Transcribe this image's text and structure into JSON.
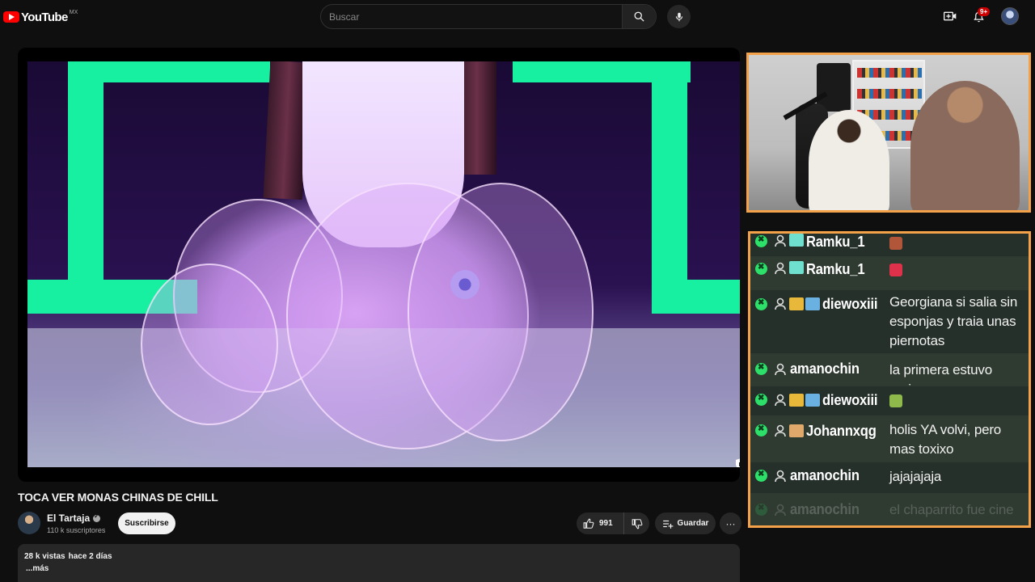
{
  "header": {
    "logo_text": "YouTube",
    "country_code": "MX",
    "search_placeholder": "Buscar",
    "notifications_badge": "9+",
    "icons": [
      "search-icon",
      "mic-icon",
      "create-icon",
      "bell-icon",
      "avatar"
    ]
  },
  "video": {
    "title": "TOCA VER MONAS CHINAS DE CHILL",
    "channel_name": "El Tartaja",
    "subscribers": "110 k suscriptores",
    "subscribe_label": "Suscribirse",
    "likes": "991",
    "save_label": "Guardar",
    "more_label": "···",
    "views": "28 k vistas",
    "date": "hace 2 días",
    "more_desc": "...más"
  },
  "chat": {
    "messages": [
      {
        "user": "Ramku_1",
        "text": "",
        "emote_color": "#b2563a"
      },
      {
        "user": "Ramku_1",
        "text": "",
        "emote_color": "#e0314b"
      },
      {
        "user": "diewoxiii",
        "text": "Georgiana si salia sin esponjas y traia unas piernotas"
      },
      {
        "user": "amanochin",
        "text": "la primera estuvo mejor"
      },
      {
        "user": "diewoxiii",
        "text": "",
        "emote_color": "#8fb94a"
      },
      {
        "user": "Johannxqg",
        "text": "holis YA volvi, pero mas toxixo"
      },
      {
        "user": "amanochin",
        "text": "jajajajaja"
      },
      {
        "user": "amanochin",
        "text": "el chaparrito fue cine"
      }
    ]
  },
  "colors": {
    "accent_border": "#f4a24a",
    "chat_bg": "#2f3a31",
    "youtube_red": "#ff0000"
  }
}
